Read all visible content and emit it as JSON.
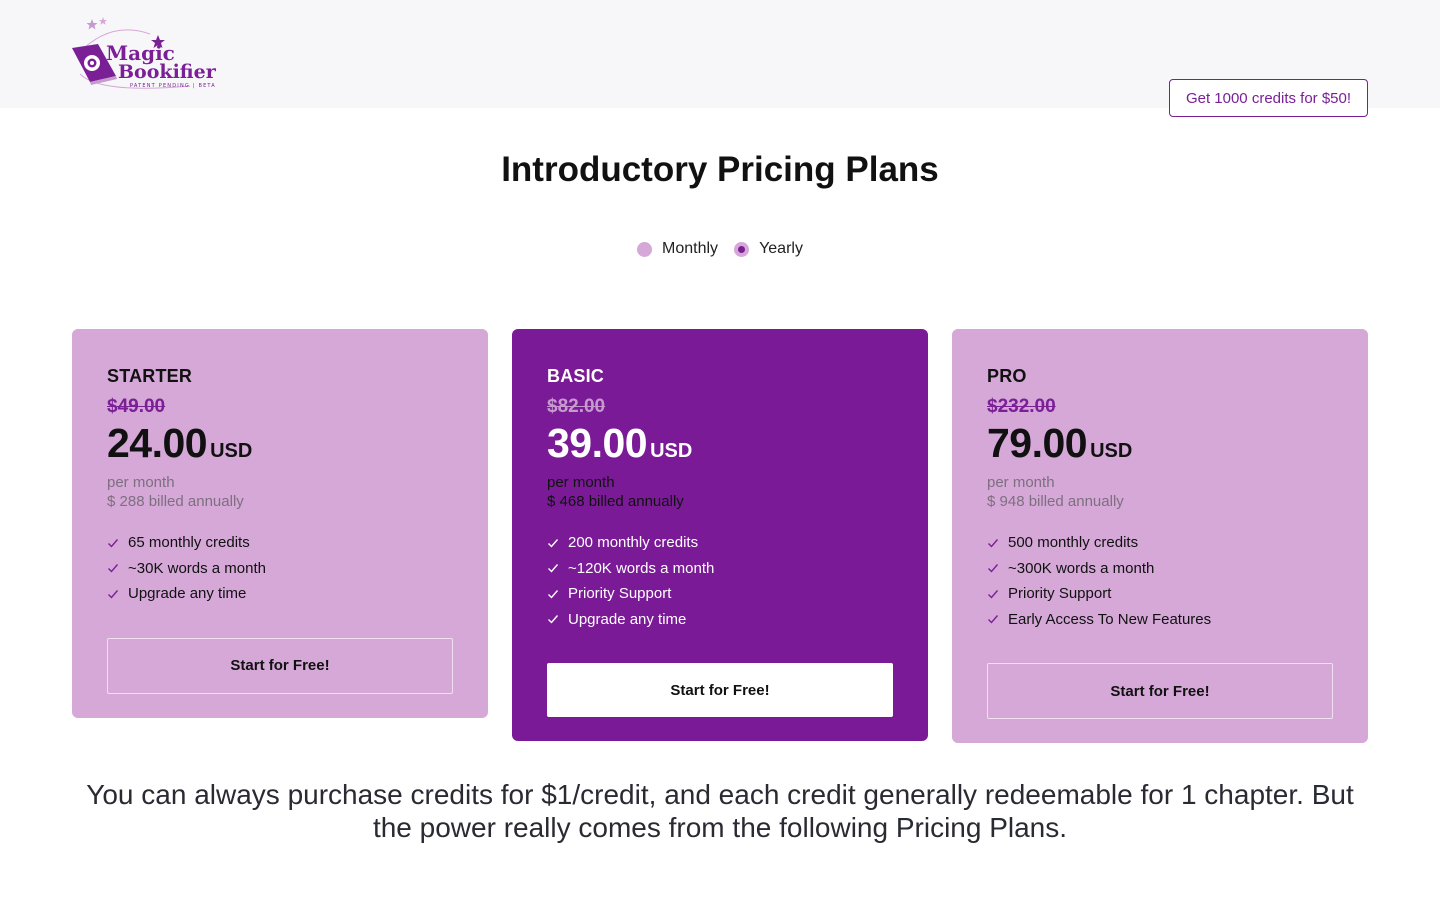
{
  "header": {
    "logo": {
      "line1": "Magic",
      "line2": "Bookifier",
      "tagline": "PATENT PENDING | BETA"
    },
    "credits_button": "Get 1000 credits for $50!"
  },
  "title": "Introductory Pricing Plans",
  "billing_toggle": {
    "options": [
      {
        "label": "Monthly",
        "selected": false
      },
      {
        "label": "Yearly",
        "selected": true
      }
    ]
  },
  "plans": [
    {
      "name": "STARTER",
      "old_price": "$49.00",
      "price": "24.00",
      "currency": "USD",
      "per": "per month",
      "billed": "$ 288 billed annually",
      "features": [
        "65 monthly credits",
        "~30K words a month",
        "Upgrade any time"
      ],
      "cta": "Start for Free!"
    },
    {
      "name": "BASIC",
      "old_price": "$82.00",
      "price": "39.00",
      "currency": "USD",
      "per": "per month",
      "billed": "$ 468 billed annually",
      "features": [
        "200 monthly credits",
        "~120K words a month",
        "Priority Support",
        "Upgrade any time"
      ],
      "cta": "Start for Free!"
    },
    {
      "name": "PRO",
      "old_price": "$232.00",
      "price": "79.00",
      "currency": "USD",
      "per": "per month",
      "billed": "$ 948 billed annually",
      "features": [
        "500 monthly credits",
        "~300K words a month",
        "Priority Support",
        "Early Access To New Features"
      ],
      "cta": "Start for Free!"
    }
  ],
  "footer_text": "You can always purchase credits for $1/credit, and each credit generally redeemable for 1 chapter. But the power really comes from the following Pricing Plans.",
  "colors": {
    "brand_purple": "#7b1f97",
    "card_light": "#d5a8d8",
    "card_dark": "#7b1a97",
    "header_bg": "#f7f7f9"
  }
}
